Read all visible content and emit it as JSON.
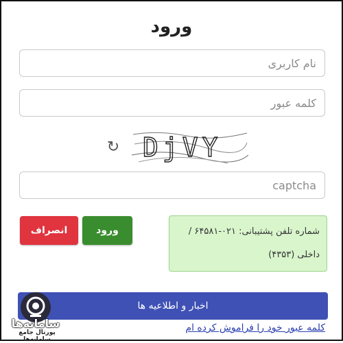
{
  "title": "ورود",
  "username": {
    "placeholder": "نام کاربری"
  },
  "password": {
    "placeholder": "کلمه عبور"
  },
  "captcha": {
    "text": "DjVY",
    "input_placeholder": "captcha"
  },
  "buttons": {
    "login": "ورود",
    "cancel": "انصراف"
  },
  "support": {
    "line1": "شماره تلفن پشتیبانی: ۰۲۱-۶۴۵۸۱ /",
    "line2": "داخلی (۴۳۵۳)"
  },
  "news_button": "اخبار و اطلاعیه ها",
  "forgot_link": "کلمه عبور خود را فراموش کرده ام",
  "logo": {
    "word": "سامانه‌ها",
    "subtitle": "پورتال جامع سامانه‌ها"
  },
  "colors": {
    "login": "#3a8d2f",
    "cancel": "#e0343f",
    "news": "#3f51b5",
    "support_bg": "#d9f5cc",
    "link": "#2a3fb0"
  },
  "icons": {
    "refresh": "refresh-icon"
  }
}
